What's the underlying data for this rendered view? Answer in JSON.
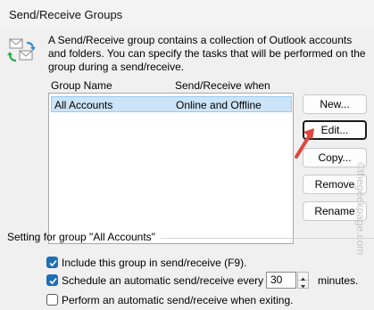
{
  "window": {
    "title": "Send/Receive Groups"
  },
  "description": "A Send/Receive group contains a collection of Outlook accounts and folders. You can specify the tasks that will be performed on the group during a send/receive.",
  "list": {
    "columns": [
      "Group Name",
      "Send/Receive when"
    ],
    "rows": [
      {
        "name": "All Accounts",
        "when": "Online and Offline",
        "selected": true
      }
    ]
  },
  "buttons": {
    "new": "New...",
    "edit": "Edit...",
    "copy": "Copy...",
    "remove": "Remove",
    "rename": "Rename"
  },
  "settings": {
    "group_title": "Setting for group \"All Accounts\"",
    "include": {
      "label": "Include this group in send/receive (F9).",
      "checked": true
    },
    "schedule": {
      "label": "Schedule an automatic send/receive every",
      "checked": true,
      "value": "30",
      "unit": "minutes."
    },
    "exit": {
      "label": "Perform an automatic send/receive when exiting.",
      "checked": false
    }
  },
  "watermark": "©thegeekpage.com",
  "colors": {
    "selection": "#cce4f7",
    "checkbox": "#1f6fb5",
    "arrow": "#e0463c"
  },
  "icons": [
    "send-receive-icon",
    "checkmark-icon",
    "spin-up-icon",
    "spin-down-icon",
    "arrow-annotation-icon"
  ]
}
